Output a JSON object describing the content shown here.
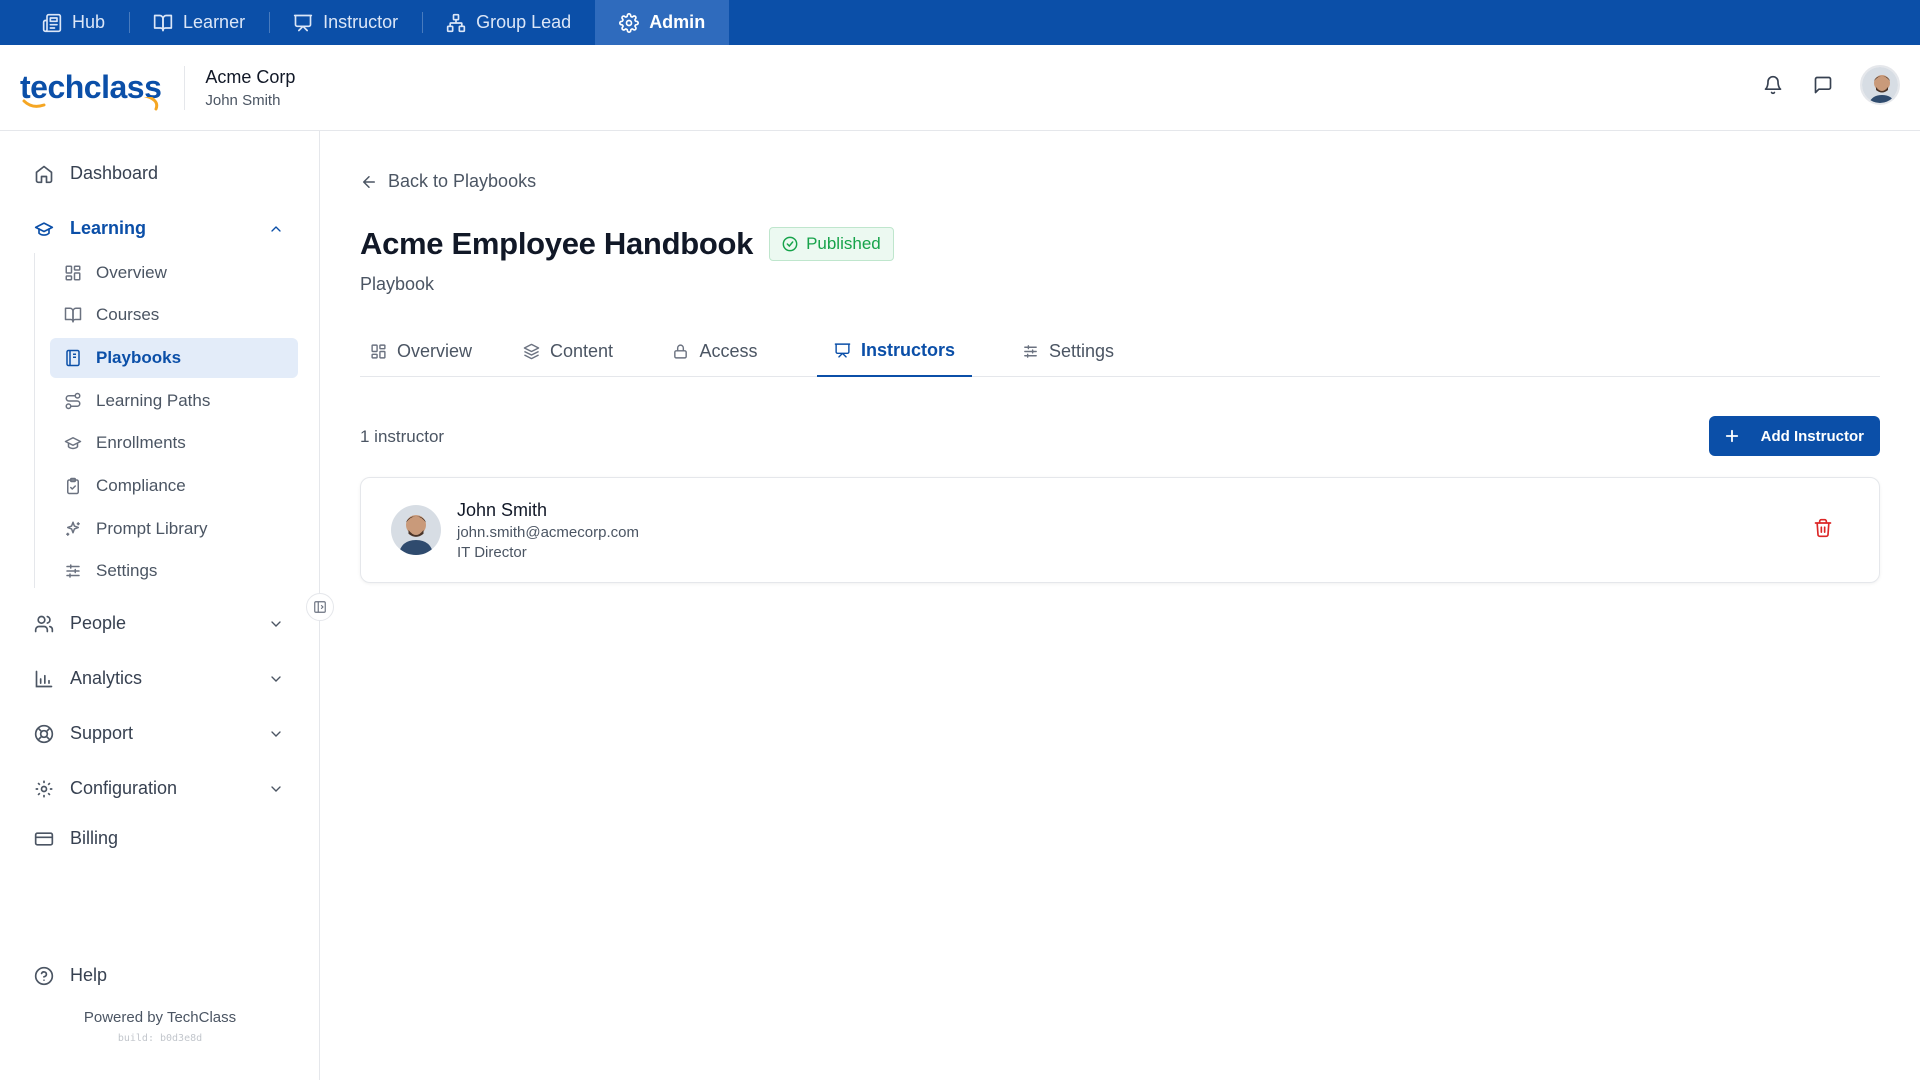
{
  "role_bar": {
    "items": [
      {
        "label": "Hub",
        "icon": "newspaper-icon"
      },
      {
        "label": "Learner",
        "icon": "book-open-icon"
      },
      {
        "label": "Instructor",
        "icon": "presentation-icon"
      },
      {
        "label": "Group Lead",
        "icon": "network-icon"
      },
      {
        "label": "Admin",
        "icon": "gear-icon",
        "active": true
      }
    ]
  },
  "header": {
    "logo_text": "techclass",
    "org_name": "Acme Corp",
    "user_name": "John Smith"
  },
  "sidebar": {
    "dashboard": "Dashboard",
    "learning": "Learning",
    "learning_items": [
      {
        "label": "Overview",
        "icon": "grid-icon"
      },
      {
        "label": "Courses",
        "icon": "book-open-icon"
      },
      {
        "label": "Playbooks",
        "icon": "notebook-icon",
        "active": true
      },
      {
        "label": "Learning Paths",
        "icon": "route-icon"
      },
      {
        "label": "Enrollments",
        "icon": "graduation-cap-icon"
      },
      {
        "label": "Compliance",
        "icon": "clipboard-check-icon"
      },
      {
        "label": "Prompt Library",
        "icon": "sparkles-icon"
      },
      {
        "label": "Settings",
        "icon": "sliders-icon"
      }
    ],
    "people": "People",
    "analytics": "Analytics",
    "support": "Support",
    "configuration": "Configuration",
    "billing": "Billing",
    "help": "Help",
    "powered_by": "Powered by TechClass",
    "build": "build: b0d3e8d"
  },
  "main": {
    "back_label": "Back to Playbooks",
    "title": "Acme Employee Handbook",
    "status_badge": "Published",
    "subtitle": "Playbook",
    "tabs": [
      {
        "label": "Overview",
        "icon": "grid-icon"
      },
      {
        "label": "Content",
        "icon": "layers-icon"
      },
      {
        "label": "Access",
        "icon": "lock-icon"
      },
      {
        "label": "Instructors",
        "icon": "presentation-icon",
        "active": true
      },
      {
        "label": "Settings",
        "icon": "sliders-icon"
      }
    ],
    "instructor_count": "1 instructor",
    "add_button": "Add Instructor",
    "instructors": [
      {
        "name": "John Smith",
        "email": "john.smith@acmecorp.com",
        "role": "IT Director"
      }
    ]
  },
  "colors": {
    "brand": "#0b4fa8",
    "active_tab_bg": "#2f6bbd",
    "published_green": "#16a34a",
    "delete_red": "#dc2626"
  }
}
